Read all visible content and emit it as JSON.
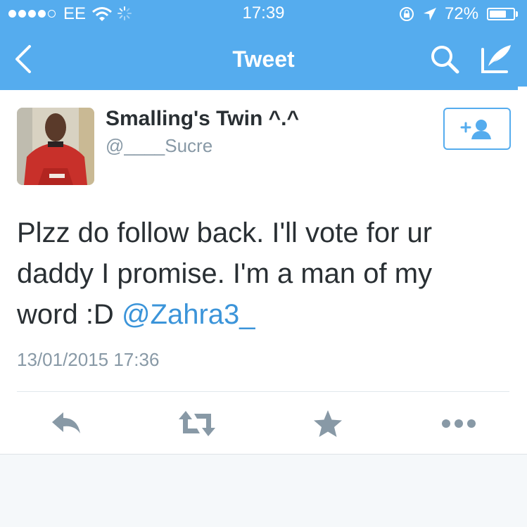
{
  "status_bar": {
    "carrier": "EE",
    "time": "17:39",
    "battery_percent": "72%",
    "battery_level": 0.72,
    "signal_bars": 4,
    "signal_total": 5
  },
  "nav": {
    "title": "Tweet",
    "back_icon": "chevron-left-icon",
    "search_icon": "search-icon",
    "compose_icon": "compose-icon"
  },
  "tweet": {
    "display_name": "Smalling's Twin ^.^",
    "handle": "@____Sucre",
    "text_lines": [
      "Plzz do follow back. I'll vote for ur",
      "daddy I promise. I'm a man of my",
      "word :D"
    ],
    "mention": "@Zahra3_",
    "timestamp": "13/01/2015 17:36"
  },
  "actions": {
    "reply_icon": "reply-icon",
    "retweet_icon": "retweet-icon",
    "favorite_icon": "star-icon",
    "more_icon": "more-icon"
  },
  "colors": {
    "brand": "#55acee",
    "mention": "#3b94d9",
    "secondary_text": "#8899a6",
    "action_icon": "#8899a6"
  }
}
